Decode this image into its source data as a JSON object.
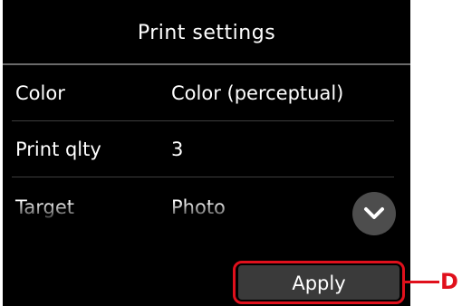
{
  "screen": {
    "title": "Print settings",
    "settings": [
      {
        "label": "Color",
        "value": "Color (perceptual)"
      },
      {
        "label": "Print qlty",
        "value": "3"
      },
      {
        "label": "Target",
        "value": "Photo"
      }
    ],
    "scroll_icon": "chevron-down-icon",
    "apply_label": "Apply"
  },
  "callout": {
    "letter": "D",
    "color": "#e0101c"
  }
}
